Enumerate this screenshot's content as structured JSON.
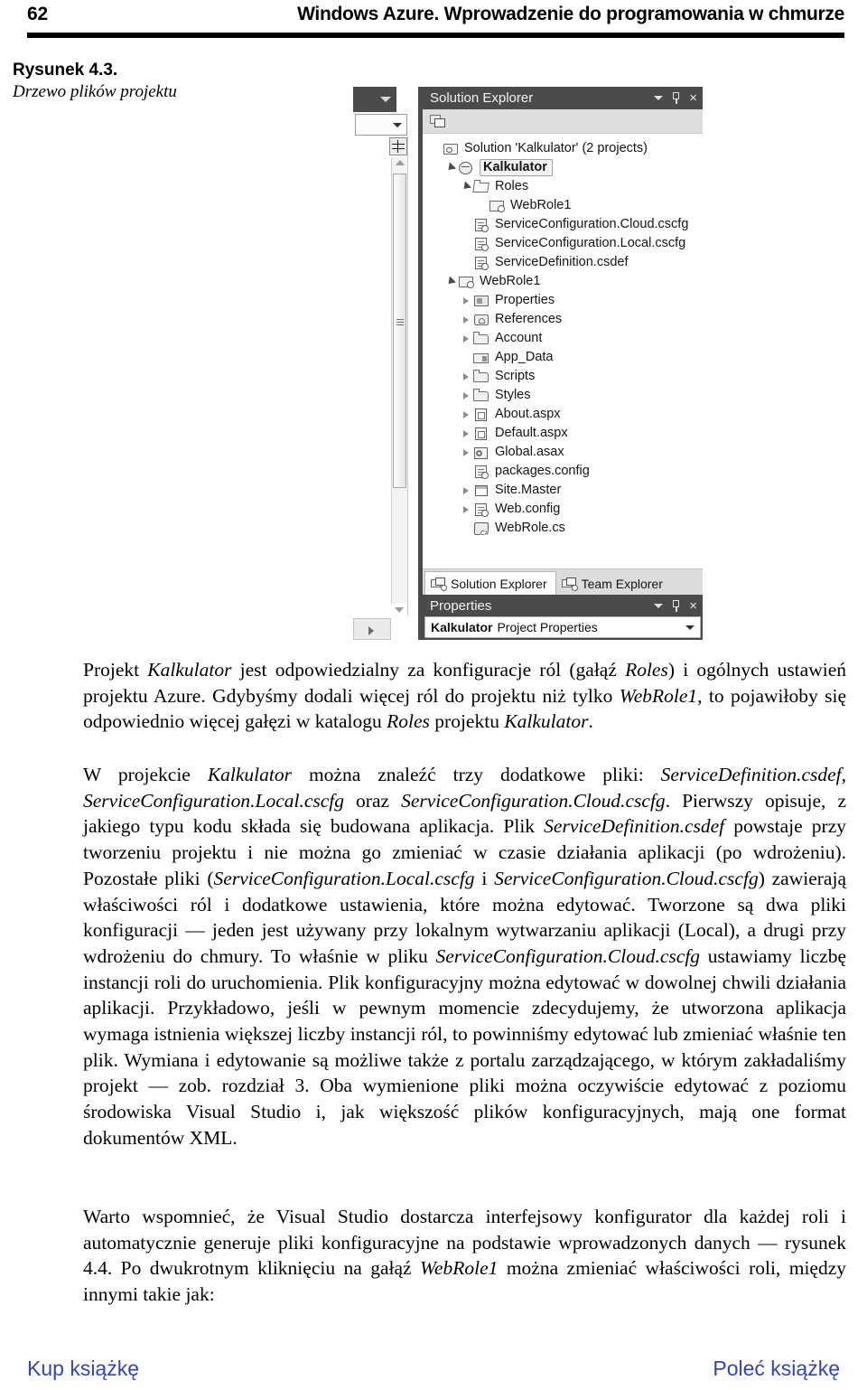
{
  "header": {
    "page_number": "62",
    "title": "Windows Azure. Wprowadzenie do programowania w chmurze"
  },
  "figure": {
    "caption_label": "Rysunek 4.3.",
    "caption_text": "Drzewo plików projektu",
    "solution_explorer": {
      "panel_title": "Solution Explorer",
      "toolbar_icon": "show-all-files-icon",
      "tree": [
        {
          "label": "Solution 'Kalkulator' (2 projects)",
          "icon": "solution-icon",
          "indent": 0,
          "expander": "none",
          "selected": false
        },
        {
          "label": "Kalkulator",
          "icon": "cloud-project-icon",
          "indent": 1,
          "expander": "open",
          "selected": true
        },
        {
          "label": "Roles",
          "icon": "folder-open-icon",
          "indent": 2,
          "expander": "open",
          "selected": false
        },
        {
          "label": "WebRole1",
          "icon": "webrole-icon",
          "indent": 3,
          "expander": "none",
          "selected": false
        },
        {
          "label": "ServiceConfiguration.Cloud.cscfg",
          "icon": "config-file-icon",
          "indent": 2,
          "expander": "none",
          "selected": false
        },
        {
          "label": "ServiceConfiguration.Local.cscfg",
          "icon": "config-file-icon",
          "indent": 2,
          "expander": "none",
          "selected": false
        },
        {
          "label": "ServiceDefinition.csdef",
          "icon": "config-file-icon",
          "indent": 2,
          "expander": "none",
          "selected": false
        },
        {
          "label": "WebRole1",
          "icon": "csharp-project-icon",
          "indent": 1,
          "expander": "open",
          "selected": false
        },
        {
          "label": "Properties",
          "icon": "properties-icon",
          "indent": 2,
          "expander": "closed",
          "selected": false
        },
        {
          "label": "References",
          "icon": "references-icon",
          "indent": 2,
          "expander": "closed",
          "selected": false
        },
        {
          "label": "Account",
          "icon": "folder-icon",
          "indent": 2,
          "expander": "closed",
          "selected": false
        },
        {
          "label": "App_Data",
          "icon": "app-data-folder-icon",
          "indent": 2,
          "expander": "none",
          "selected": false
        },
        {
          "label": "Scripts",
          "icon": "folder-icon",
          "indent": 2,
          "expander": "closed",
          "selected": false
        },
        {
          "label": "Styles",
          "icon": "folder-icon",
          "indent": 2,
          "expander": "closed",
          "selected": false
        },
        {
          "label": "About.aspx",
          "icon": "aspx-file-icon",
          "indent": 2,
          "expander": "closed",
          "selected": false
        },
        {
          "label": "Default.aspx",
          "icon": "aspx-file-icon",
          "indent": 2,
          "expander": "closed",
          "selected": false
        },
        {
          "label": "Global.asax",
          "icon": "asax-file-icon",
          "indent": 2,
          "expander": "closed",
          "selected": false
        },
        {
          "label": "packages.config",
          "icon": "config-file-icon",
          "indent": 2,
          "expander": "none",
          "selected": false
        },
        {
          "label": "Site.Master",
          "icon": "master-page-icon",
          "indent": 2,
          "expander": "closed",
          "selected": false
        },
        {
          "label": "Web.config",
          "icon": "config-file-icon",
          "indent": 2,
          "expander": "closed",
          "selected": false
        },
        {
          "label": "WebRole.cs",
          "icon": "csharp-file-icon",
          "indent": 2,
          "expander": "none",
          "selected": false
        }
      ],
      "tabs": [
        {
          "label": "Solution Explorer",
          "icon": "solution-explorer-icon",
          "active": true
        },
        {
          "label": "Team Explorer",
          "icon": "team-explorer-icon",
          "active": false
        }
      ]
    },
    "properties_panel": {
      "panel_title": "Properties",
      "object_name": "Kalkulator",
      "object_type": "Project Properties"
    },
    "titlebar_icons": [
      "chevron-down-icon",
      "pin-icon",
      "close-icon"
    ],
    "close_glyph": "×"
  },
  "body": {
    "paragraph_1": [
      {
        "t": "Projekt ",
        "i": false
      },
      {
        "t": "Kalkulator",
        "i": true
      },
      {
        "t": " jest odpowiedzialny za konfiguracje ról (gałąź ",
        "i": false
      },
      {
        "t": "Roles",
        "i": true
      },
      {
        "t": ") i ogólnych ustawień projektu Azure. Gdybyśmy dodali więcej ról do projektu niż tylko ",
        "i": false
      },
      {
        "t": "WebRole1",
        "i": true
      },
      {
        "t": ", to pojawiłoby się odpowiednio więcej gałęzi w katalogu ",
        "i": false
      },
      {
        "t": "Roles",
        "i": true
      },
      {
        "t": " projektu ",
        "i": false
      },
      {
        "t": "Kalkulator",
        "i": true
      },
      {
        "t": ".",
        "i": false
      }
    ],
    "paragraph_2": [
      {
        "t": "W projekcie ",
        "i": false
      },
      {
        "t": "Kalkulator",
        "i": true
      },
      {
        "t": " można znaleźć trzy dodatkowe pliki: ",
        "i": false
      },
      {
        "t": "ServiceDefinition.csdef",
        "i": true
      },
      {
        "t": ", ",
        "i": false
      },
      {
        "t": "ServiceConfiguration.Local.cscfg",
        "i": true
      },
      {
        "t": " oraz ",
        "i": false
      },
      {
        "t": "ServiceConfiguration.Cloud.cscfg",
        "i": true
      },
      {
        "t": ". Pierwszy opisuje, z jakiego typu kodu składa się budowana aplikacja. Plik ",
        "i": false
      },
      {
        "t": "ServiceDefinition.csdef",
        "i": true
      },
      {
        "t": " powstaje przy tworzeniu projektu i nie można go zmieniać w czasie działania aplikacji (po wdrożeniu). Pozostałe pliki (",
        "i": false
      },
      {
        "t": "ServiceConfiguration.Local.cscfg",
        "i": true
      },
      {
        "t": " i ",
        "i": false
      },
      {
        "t": "ServiceConfiguration.Cloud.cscfg",
        "i": true
      },
      {
        "t": ") zawierają właściwości ról i dodatkowe ustawienia, które można edytować. Tworzone są dwa pliki konfiguracji — jeden jest używany przy lokalnym wytwarzaniu aplikacji (Local), a drugi przy wdrożeniu do chmury. To właśnie w pliku ",
        "i": false
      },
      {
        "t": "ServiceConfiguration.Cloud.cscfg",
        "i": true
      },
      {
        "t": " ustawiamy liczbę instancji roli do uruchomienia. Plik konfiguracyjny można edytować w dowolnej chwili działania aplikacji. Przykładowo, jeśli w pewnym momencie zdecydujemy, że utworzona aplikacja wymaga istnienia większej liczby instancji ról, to powinniśmy edytować lub zmieniać właśnie ten plik. Wymiana i edytowanie są możliwe także z portalu zarządzającego, w którym zakładaliśmy projekt — zob. rozdział 3. Oba wymienione pliki można oczywiście edytować z poziomu środowiska Visual Studio i, jak większość plików konfiguracyjnych, mają one format dokumentów XML.",
        "i": false
      }
    ],
    "paragraph_3": [
      {
        "t": "Warto wspomnieć, że Visual Studio dostarcza interfejsowy konfigurator dla każdej roli i automatycznie generuje pliki konfiguracyjne na podstawie wprowadzonych danych — rysunek 4.4. Po dwukrotnym kliknięciu na gałąź ",
        "i": false
      },
      {
        "t": "WebRole1",
        "i": true
      },
      {
        "t": " można zmieniać właściwości roli, między innymi takie jak:",
        "i": false
      }
    ]
  },
  "footer": {
    "buy_label": "Kup książkę",
    "recommend_label": "Poleć książkę",
    "link_color": "#3344bb"
  }
}
